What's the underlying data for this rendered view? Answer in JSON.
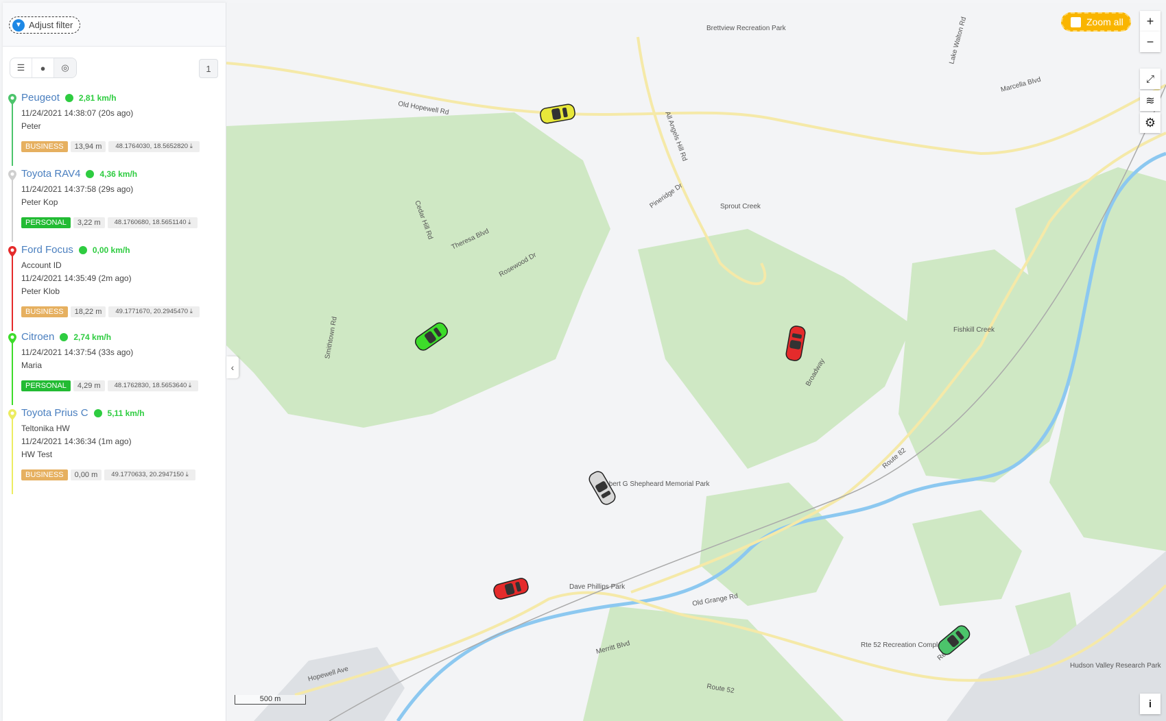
{
  "filter": {
    "label": "Adjust filter",
    "icon": "filter-icon"
  },
  "toolbar": {
    "views": [
      "list-icon",
      "dot-icon",
      "target-icon"
    ],
    "page": "1"
  },
  "vehicles": [
    {
      "name": "Peugeot",
      "speed": "2,81 km/h",
      "color": "#4cc46b",
      "lines": [
        "11/24/2021 14:38:07 (20s ago)",
        "Peter"
      ],
      "tag": "BUSINESS",
      "distance": "13,94 m",
      "coords": "48.1764030, 18.5652820"
    },
    {
      "name": "Toyota RAV4",
      "speed": "4,36 km/h",
      "color": "#cfcfcf",
      "lines": [
        "11/24/2021 14:37:58 (29s ago)",
        "Peter Kop"
      ],
      "tag": "PERSONAL",
      "distance": "3,22 m",
      "coords": "48.1760680, 18.5651140"
    },
    {
      "name": "Ford Focus",
      "speed": "0,00 km/h",
      "color": "#e52b2b",
      "lines": [
        "Account ID",
        "11/24/2021 14:35:49 (2m ago)",
        "Peter Klob"
      ],
      "tag": "BUSINESS",
      "distance": "18,22 m",
      "coords": "49.1771670, 20.2945470"
    },
    {
      "name": "Citroen",
      "speed": "2,74 km/h",
      "color": "#3ddc2a",
      "lines": [
        "11/24/2021 14:37:54 (33s ago)",
        "Maria"
      ],
      "tag": "PERSONAL",
      "distance": "4,29 m",
      "coords": "48.1762830, 18.5653640"
    },
    {
      "name": "Toyota Prius C",
      "speed": "5,11 km/h",
      "color": "#ecec60",
      "lines": [
        "Teltonika HW",
        "11/24/2021 14:36:34 (1m ago)",
        "HW Test"
      ],
      "tag": "BUSINESS",
      "distance": "0,00 m",
      "coords": "49.1770633, 20.2947150"
    }
  ],
  "map": {
    "zoom_all": "Zoom all",
    "scale": "500 m",
    "info": "i",
    "labels": [
      "Old Hopewell Rd",
      "Route 82",
      "Route 52",
      "All Angels Hill Rd",
      "Cedar Hill Rd",
      "Pineridge Dr",
      "Theresa Blvd",
      "Rosewood Dr",
      "Smithtown Rd",
      "Broadway",
      "Lake Walton Rd",
      "Marcella Blvd",
      "Fishkill Creek",
      "Sprout Creek",
      "Brettview Recreation Park",
      "Robert G Shepheard Memorial Park",
      "Dave Phillips Park",
      "Rte 52 Recreation Complex",
      "Hudson Valley Research Park",
      "Old Grange Rd",
      "Hopewell Ave",
      "Merritt Blvd",
      "Research Dr"
    ]
  },
  "colors": {
    "accent": "#f9b500",
    "link": "#4a7fbf",
    "speed": "#2ecc40",
    "business": "#e6b060",
    "personal": "#22bb33"
  }
}
